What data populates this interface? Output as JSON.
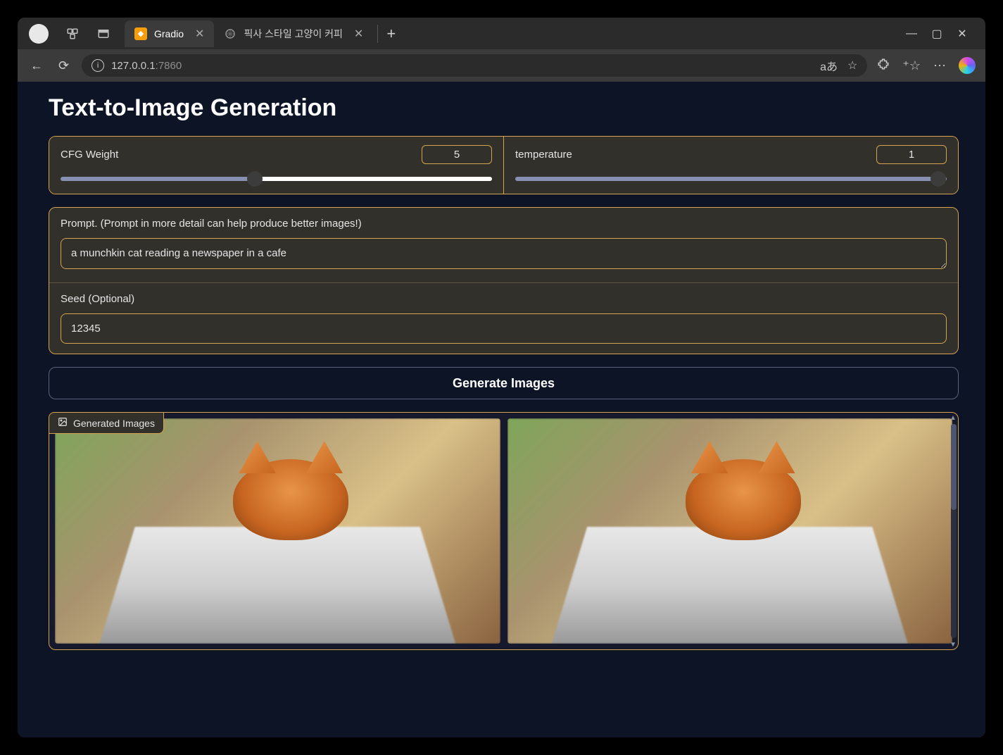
{
  "browser": {
    "tabs": [
      {
        "title": "Gradio",
        "active": true
      },
      {
        "title": "픽사 스타일 고양이 커피",
        "active": false
      }
    ],
    "address": {
      "host": "127.0.0.1",
      "port": ":7860"
    },
    "lang_indicator": "aあ"
  },
  "page": {
    "title": "Text-to-Image Generation",
    "sliders": {
      "cfg": {
        "label": "CFG Weight",
        "value": "5",
        "percent": 45
      },
      "temperature": {
        "label": "temperature",
        "value": "1",
        "percent": 98
      }
    },
    "prompt": {
      "label": "Prompt. (Prompt in more detail can help produce better images!)",
      "value": "a munchkin cat reading a newspaper in a cafe"
    },
    "seed": {
      "label": "Seed (Optional)",
      "value": "12345"
    },
    "generate_label": "Generate Images",
    "gallery_label": "Generated Images"
  }
}
